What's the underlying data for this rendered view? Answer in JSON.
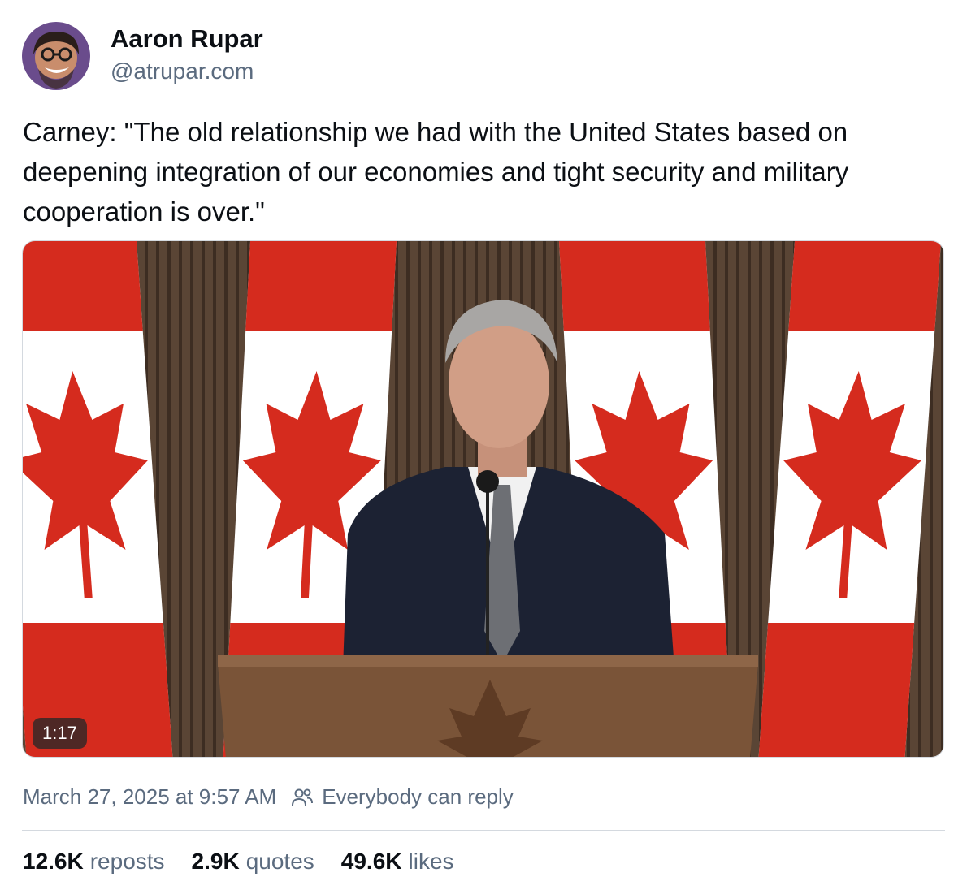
{
  "author": {
    "name": "Aaron Rupar",
    "handle": "@atrupar.com",
    "avatar_icon": "user-avatar-icon"
  },
  "post": {
    "text": "Carney: \"The old relationship we had with the United States based on deepening integration of our economies and tight security and military cooperation is over.\""
  },
  "media": {
    "type": "video",
    "duration": "1:17"
  },
  "meta": {
    "timestamp": "March 27, 2025 at 9:57 AM",
    "reply_setting": "Everybody can reply",
    "reply_icon": "people-icon"
  },
  "stats": {
    "reposts": {
      "count": "12.6K",
      "label": "reposts"
    },
    "quotes": {
      "count": "2.9K",
      "label": "quotes"
    },
    "likes": {
      "count": "49.6K",
      "label": "likes"
    }
  },
  "colors": {
    "text_primary": "#0b0f14",
    "text_secondary": "#5b6b7f",
    "divider": "#d4d9df",
    "flag_red": "#d52b1e"
  }
}
